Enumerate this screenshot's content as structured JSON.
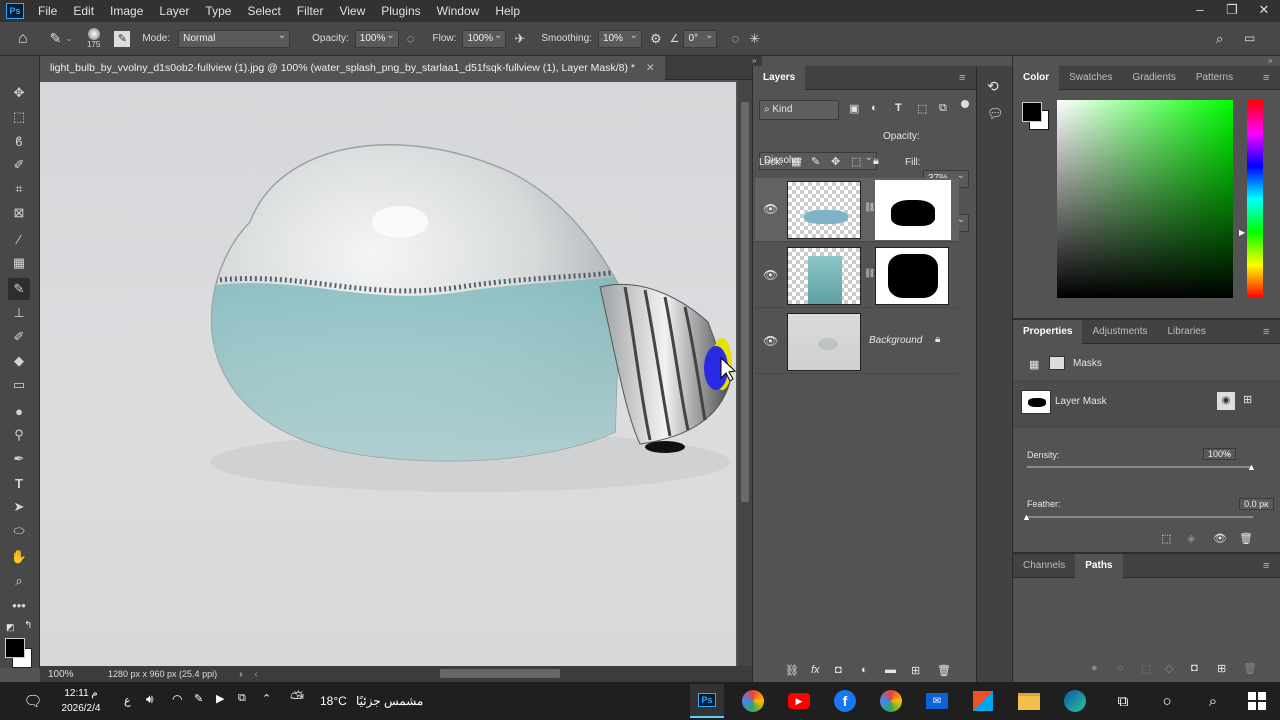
{
  "menubar": {
    "logo": "Ps",
    "items": [
      "File",
      "Edit",
      "Image",
      "Layer",
      "Type",
      "Select",
      "Filter",
      "View",
      "Plugins",
      "Window",
      "Help"
    ]
  },
  "options": {
    "brush_size": "175",
    "mode_label": "Mode:",
    "mode_value": "Normal",
    "opacity_label": "Opacity:",
    "opacity_value": "100%",
    "flow_label": "Flow:",
    "flow_value": "100%",
    "smoothing_label": "Smoothing:",
    "smoothing_value": "10%",
    "angle_value": "0°"
  },
  "document": {
    "tab_title": "light_bulb_by_vvolny_d1s0ob2-fullview (1).jpg @ 100% (water_splash_png_by_starlaa1_d51fsqk-fullview (1), Layer Mask/8) *",
    "zoom": "100%",
    "info": "1280 px x 960 px (25.4 ppi)"
  },
  "layers": {
    "title": "Layers",
    "filter": "Kind",
    "blend_mode": "Dissolve",
    "opacity_label": "Opacity:",
    "opacity_value": "37%",
    "lock_label": "Lock:",
    "fill_label": "Fill:",
    "fill_value": "100%",
    "background_label": "Background"
  },
  "color": {
    "tabs": [
      "Color",
      "Swatches",
      "Gradients",
      "Patterns"
    ]
  },
  "properties": {
    "tabs": [
      "Properties",
      "Adjustments",
      "Libraries"
    ],
    "masks_label": "Masks",
    "layer_mask_label": "Layer Mask",
    "density_label": "Density:",
    "density_value": "100%",
    "feather_label": "Feather:",
    "feather_value": "0.0 px"
  },
  "bottom_tabs": [
    "Channels",
    "Paths"
  ],
  "taskbar": {
    "time": "12:11 م",
    "date": "2026/2/4",
    "lang": "ع",
    "weather_temp": "18°C",
    "weather_desc": "مشمس جزئيًا"
  }
}
